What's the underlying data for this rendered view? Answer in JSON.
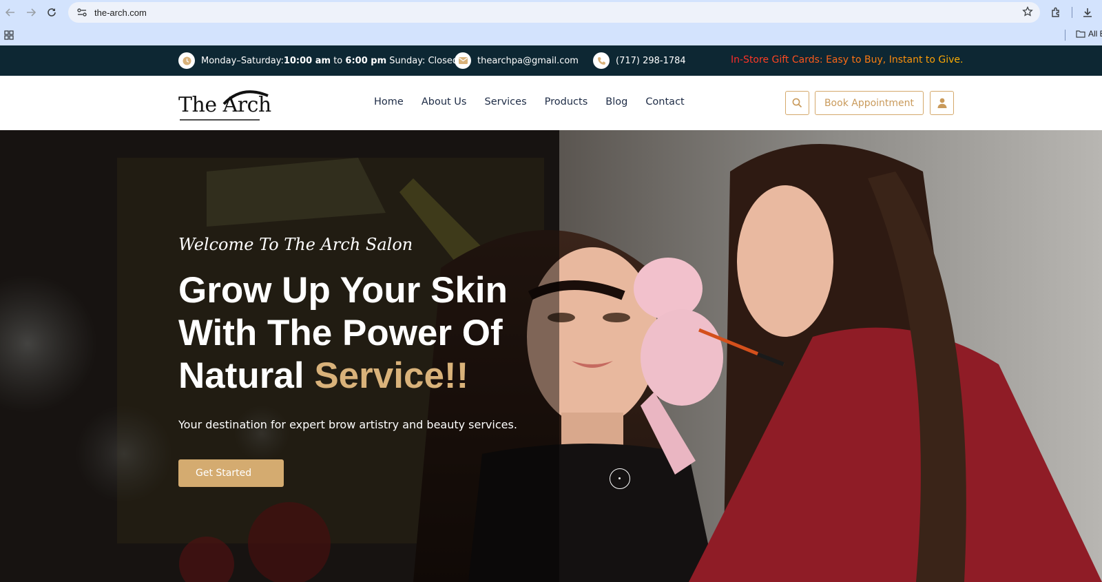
{
  "browser": {
    "url": "the-arch.com",
    "bookmarks_all_label": "All Bookmarks"
  },
  "topbar": {
    "hours_prefix": "Monday–Saturday: ",
    "hours_open": "10:00 am",
    "hours_to": " to ",
    "hours_close": "6:00 pm",
    "hours_sunday": " Sunday: Closed",
    "email": "thearchpa@gmail.com",
    "phone": "(717) 298-1784",
    "promo": "In-Store Gift Cards: Easy to Buy, Instant to Give.",
    "icons": [
      "clock-icon",
      "mail-icon",
      "phone-icon"
    ],
    "icon_color": "#d9b27a"
  },
  "header": {
    "logo_text": "The Arch",
    "nav": [
      "Home",
      "About Us",
      "Services",
      "Products",
      "Blog",
      "Contact"
    ],
    "book_label": "Book Appointment",
    "accent": "#c99a5b"
  },
  "hero": {
    "welcome": "Welcome To The Arch Salon",
    "title_line1": "Grow Up Your Skin",
    "title_line2": "With The Power Of",
    "title_line3_plain": "Natural ",
    "title_line3_accent": "Service!!",
    "subtitle": "Your destination for expert brow artistry and beauty services.",
    "cta_label": "Get Started",
    "accent": "#d9b27a"
  }
}
